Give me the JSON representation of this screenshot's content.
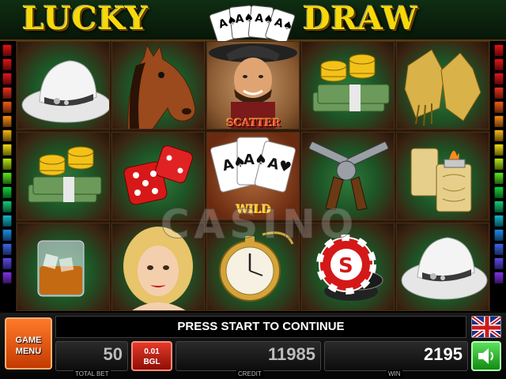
{
  "title": {
    "left_word": "LUCKY",
    "right_word": "DRAW"
  },
  "reels": [
    {
      "symbols": [
        "cowboy-hat-icon",
        "money-stack-icon",
        "whiskey-glass-icon"
      ]
    },
    {
      "symbols": [
        "horse-icon",
        "dice-icon",
        "lady-portrait-icon"
      ]
    },
    {
      "symbols": [
        "scatter-cowboy-icon",
        "wild-cards-icon",
        "pocket-watch-icon"
      ]
    },
    {
      "symbols": [
        "money-stack-icon",
        "revolvers-icon",
        "casino-chip-icon"
      ]
    },
    {
      "symbols": [
        "gloves-icon",
        "lighter-icon",
        "cowboy-hat-icon"
      ]
    }
  ],
  "reel_labels": {
    "scatter": "SCATTER",
    "wild": "WILD"
  },
  "watermark": "CASINO",
  "panel": {
    "game_menu_line1": "GAME",
    "game_menu_line2": "MENU",
    "message": "PRESS START TO CONTINUE",
    "total_bet_value": "50",
    "total_bet_caption": "TOTAL BET",
    "denom_line1": "0.01",
    "denom_line2": "BGL",
    "credit_value": "11985",
    "credit_caption": "CREDIT",
    "win_value": "2195",
    "win_caption": "WIN"
  },
  "colors": {
    "title_gold": "#f5d90a",
    "felt_green": "#1d5426",
    "menu_orange": "#ff7a2a",
    "denom_red": "#e33a2a",
    "sound_green": "#5ce05c"
  },
  "side_light_colors": [
    "#e01414",
    "#e01414",
    "#e0141e",
    "#e8321a",
    "#f05a14",
    "#f58a14",
    "#f5b414",
    "#f0dc14",
    "#b4e614",
    "#5ae61e",
    "#14d23c",
    "#14c878",
    "#14b4c8",
    "#1e8ae6",
    "#3c64e6",
    "#5a4ae6",
    "#8232e6"
  ]
}
